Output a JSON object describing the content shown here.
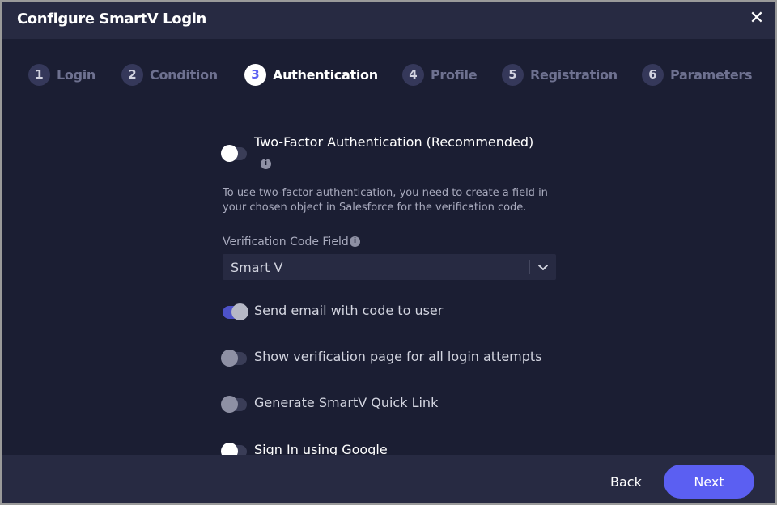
{
  "header": {
    "title": "Configure SmartV Login",
    "close_icon": "close-icon"
  },
  "steps": [
    {
      "number": "1",
      "label": "Login",
      "active": false
    },
    {
      "number": "2",
      "label": "Condition",
      "active": false
    },
    {
      "number": "3",
      "label": "Authentication",
      "active": true
    },
    {
      "number": "4",
      "label": "Profile",
      "active": false
    },
    {
      "number": "5",
      "label": "Registration",
      "active": false
    },
    {
      "number": "6",
      "label": "Parameters",
      "active": false
    }
  ],
  "auth": {
    "two_factor": {
      "label": "Two-Factor Authentication (Recommended)",
      "enabled": false,
      "info_glyph": "i"
    },
    "description": "To use two-factor authentication, you need to create a field in your chosen object in Salesforce for the verification code.",
    "verification_field": {
      "label": "Verification Code Field",
      "info_glyph": "i",
      "value": "Smart V"
    },
    "options": [
      {
        "label": "Send email with code to user",
        "enabled": true
      },
      {
        "label": "Show verification page for all login attempts",
        "enabled": false
      },
      {
        "label": "Generate SmartV Quick Link",
        "enabled": false
      }
    ],
    "google_sign_in": {
      "label": "Sign In using Google",
      "enabled": false
    }
  },
  "footer": {
    "back_label": "Back",
    "next_label": "Next"
  },
  "colors": {
    "background": "#1b1e33",
    "panel": "#272a42",
    "accent": "#5b5ff2",
    "toggle_on": "#4d52c9"
  }
}
